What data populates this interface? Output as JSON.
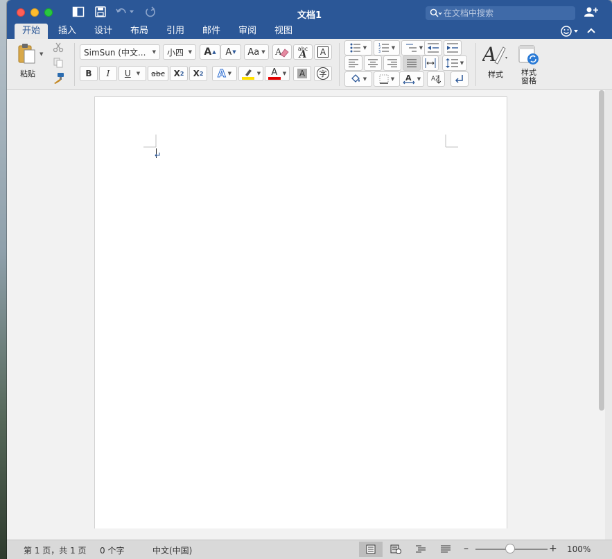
{
  "window": {
    "title": "文档1",
    "search_placeholder": "在文档中搜索"
  },
  "tabs": [
    {
      "label": "开始",
      "active": true
    },
    {
      "label": "插入"
    },
    {
      "label": "设计"
    },
    {
      "label": "布局"
    },
    {
      "label": "引用"
    },
    {
      "label": "邮件"
    },
    {
      "label": "审阅"
    },
    {
      "label": "视图"
    }
  ],
  "ribbon": {
    "paste_label": "粘贴",
    "font_name": "SimSun (中文...",
    "font_size": "小四",
    "bold": "B",
    "italic": "I",
    "underline": "U",
    "strikethrough": "abc",
    "subscript": "X",
    "subscript_mark": "2",
    "superscript": "X",
    "superscript_mark": "2",
    "grow_font": "A",
    "shrink_font": "A",
    "change_case": "Aa",
    "phonetic_top": "abc",
    "phonetic_bottom": "A",
    "char_border": "A",
    "text_effects": "A",
    "font_color": "A",
    "char_shading": "A",
    "enclose_char": "字",
    "sort_az": "AZ",
    "styles_label": "样式",
    "styles_pane_label": "样式\n窗格"
  },
  "colors": {
    "brand": "#2b5797",
    "highlight": "#ffe000",
    "font_color": "#e00000"
  },
  "status": {
    "page": "第 1 页，共 1 页",
    "words": "0 个字",
    "language": "中文(中国)",
    "zoom": "100%",
    "zoom_minus": "–",
    "zoom_plus": "+"
  }
}
